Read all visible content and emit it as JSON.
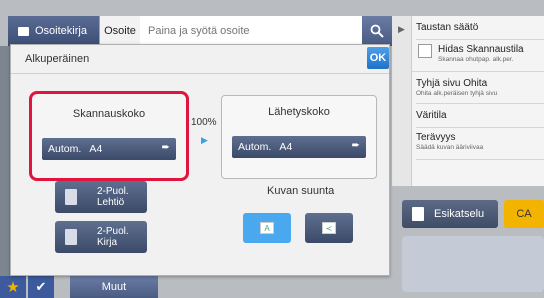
{
  "topbar": {
    "addressbook_label": "Osoitekirja",
    "address_label": "Osoite",
    "address_placeholder": "Paina ja syötä osoite"
  },
  "dialog": {
    "title": "Alkuperäinen",
    "ok_label": "OK",
    "scan_size": {
      "label": "Skannauskoko",
      "value": "Autom.   A4"
    },
    "ratio": "100%",
    "send_size": {
      "label": "Lähetyskoko",
      "value": "Autom.   A4"
    },
    "duplex_tablet": {
      "line1": "2-Puol.",
      "line2": "Lehtiö"
    },
    "duplex_booklet": {
      "line1": "2-Puol.",
      "line2": "Kirja"
    },
    "orientation": {
      "label": "Kuvan suunta"
    }
  },
  "right_panel": {
    "items": [
      {
        "title": "Taustan säätö",
        "subtitle": ""
      },
      {
        "title": "Hidas Skannaustila",
        "subtitle": "Skannaa ohutpap. alk.per."
      },
      {
        "title": "Tyhjä sivu Ohita",
        "subtitle": "Ohita alk.peräisen tyhjä sivu"
      },
      {
        "title": "Väritila",
        "subtitle": ""
      },
      {
        "title": "Terävyys",
        "subtitle": "Säädä kuvan ääriviivaa"
      }
    ],
    "preview_label": "Esikatselu",
    "ca_label": "CA"
  },
  "bottombar": {
    "more_label": "Muut"
  },
  "colors": {
    "highlight": "#e0143c",
    "ok_blue": "#1e72c8",
    "ca_yellow": "#f2b400",
    "button_dark": "#3b4a68"
  }
}
